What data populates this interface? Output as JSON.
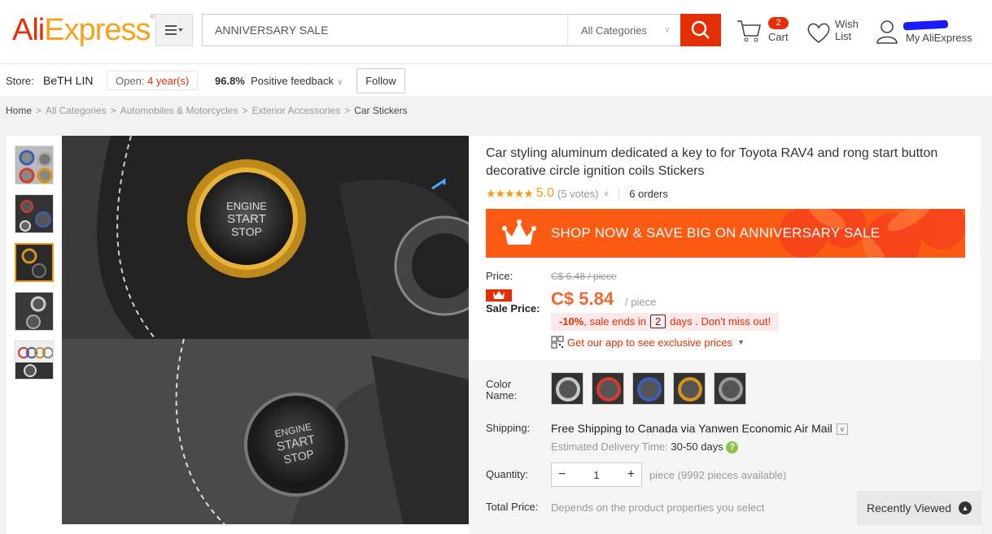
{
  "header": {
    "logo": {
      "part1": "Ali",
      "part2": "Express",
      "mark": "®"
    },
    "search": {
      "value": "ANNIVERSARY SALE"
    },
    "category_select": "All Categories",
    "cart": {
      "label": "Cart",
      "count": "2"
    },
    "wishlist": {
      "line1": "Wish",
      "line2": "List"
    },
    "account": {
      "label": "My AliExpress"
    }
  },
  "store": {
    "label": "Store:",
    "name": "BeTH LIN",
    "open_label": "Open:",
    "open_years": "4 year(s)",
    "feedback_pct": "96.8%",
    "feedback_label": "Positive feedback",
    "follow_label": "Follow"
  },
  "breadcrumb": [
    "Home",
    "All Categories",
    "Automobiles & Motorcycles",
    "Exterior Accessories",
    "Car Stickers"
  ],
  "product": {
    "title": "Car styling aluminum dedicated a key to for Toyota RAV4 and rong start button decorative circle ignition coils Stickers",
    "rating": {
      "stars": "★★★★★",
      "score": "5.0",
      "votes": "(5 votes)",
      "orders": "6 orders"
    },
    "banner": "SHOP NOW & SAVE BIG ON ANNIVERSARY SALE",
    "price_label": "Price:",
    "original_price": "C$ 6.48 / piece",
    "sale_label": "Sale Price:",
    "sale_price": "C$ 5.84",
    "sale_unit": "/ piece",
    "discount": "-10%",
    "promo_pre": ", sale ends in",
    "promo_days": "2",
    "promo_post": "days . Don't miss out!",
    "app_text": "Get our app to see exclusive prices",
    "image_text": {
      "line1": "ENGINE",
      "line2": "START",
      "line3": "STOP"
    }
  },
  "options": {
    "color_label": "Color Name:",
    "swatch_colors": [
      "#c9c9c9",
      "#d43a2f",
      "#3b5fb8",
      "#d9931c",
      "#9a9a9a"
    ],
    "shipping_label": "Shipping:",
    "shipping_strong": "Free Shipping",
    "shipping_rest": "to Canada via Yanwen Economic Air Mail",
    "eta_label": "Estimated Delivery Time:",
    "eta_value": "30-50 days",
    "quantity_label": "Quantity:",
    "quantity": "1",
    "available": "piece (9992 pieces available)",
    "total_label": "Total Price:",
    "total_value": "Depends on the product properties you select"
  },
  "recently_viewed": "Recently Viewed",
  "colors": {
    "accent": "#e62e04",
    "orange": "#f5652d",
    "banner": "#fd5b14",
    "gold": "#f39c12"
  }
}
